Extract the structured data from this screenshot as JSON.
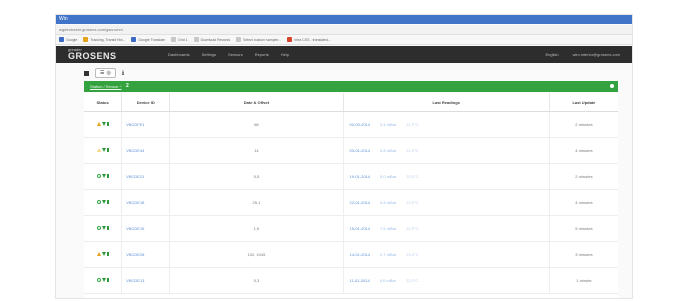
{
  "browser": {
    "title": "Win",
    "url": "wgdevicesbr.grosens.com/gsw.smm"
  },
  "bookmarks": [
    {
      "label": "Google",
      "color": "#3a6cc8"
    },
    {
      "label": "Tracking, Transit Hot...",
      "color": "#e2a21c"
    },
    {
      "label": "Google Translate",
      "color": "#3a6cc8"
    },
    {
      "label": "Grid 1",
      "color": "#c8c8c8"
    },
    {
      "label": "Download Records",
      "color": "#c8c8c8"
    },
    {
      "label": "Select custom sampler...",
      "color": "#c8c8c8"
    },
    {
      "label": "Intra CSS - translated...",
      "color": "#d8432c"
    }
  ],
  "app": {
    "logo_line1": "greader",
    "logo_line2": "GROSENS",
    "nav": [
      "Dashboards",
      "Settings",
      "Sensors",
      "Reports",
      "Help"
    ],
    "nav_right": [
      "English",
      "wim.interior@grosens.com"
    ]
  },
  "toolbar": {
    "info_glyph": "ℹ"
  },
  "group": {
    "title": "Station / Sensor ^",
    "count": "2"
  },
  "table": {
    "headers": [
      "Status",
      "Device ID",
      "Date & Offset",
      "Last Readings",
      "Last Update"
    ],
    "rows": [
      {
        "status": "warn",
        "id": "VBCDFE1",
        "offset": "68",
        "date": "02-03-2014",
        "v1": "3.4 mBar",
        "v2": "21.0°C",
        "upd": "2 minutes"
      },
      {
        "status": "warn-pale",
        "id": "VBCDE44",
        "offset": "14",
        "date": "03-01-2014",
        "v1": "0.8 mBar",
        "v2": "21.0°C",
        "upd": "4 minutes"
      },
      {
        "status": "ok",
        "id": "VBCDE21",
        "offset": "5,5",
        "date": "19-01-2014",
        "v1": "0.0 mBar",
        "v2": "22.0°C",
        "upd": "2 minutes"
      },
      {
        "status": "ok",
        "id": "VBCDE18",
        "offset": "25,1",
        "date": "22-01-2014",
        "v1": "0.8 mBar",
        "v2": "22.0°C",
        "upd": "4 minutes"
      },
      {
        "status": "ok",
        "id": "VBCDE15",
        "offset": "1,9",
        "date": "15-01-2014",
        "v1": "7.6 mBar",
        "v2": "22.0°C",
        "upd": "9 minutes"
      },
      {
        "status": "warn",
        "id": "VBCDE28",
        "offset": "102, 1045",
        "date": "14-01-2014",
        "v1": "2.7 mBar",
        "v2": "23.0°C",
        "upd": "3 minutes"
      },
      {
        "status": "ok",
        "id": "VBCDE13",
        "offset": "5,3",
        "date": "11-01-2014",
        "v1": "0.0 mBar",
        "v2": "22.0°C",
        "upd": "1 minute"
      }
    ]
  }
}
